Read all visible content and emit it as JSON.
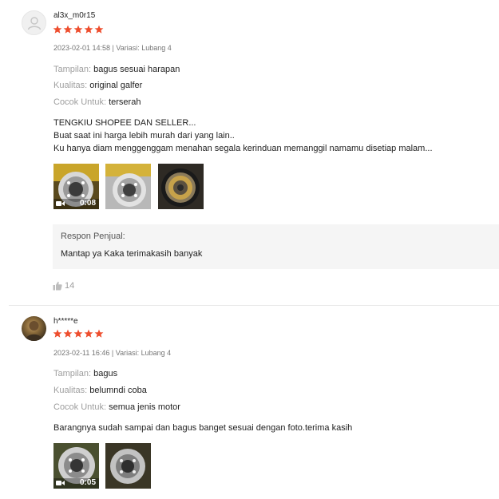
{
  "reviews": [
    {
      "username": "al3x_m0r15",
      "rating": 5,
      "meta": "2023-02-01 14:58 | Variasi: Lubang 4",
      "attributes": [
        {
          "key": "Tampilan:",
          "value": "bagus sesuai harapan"
        },
        {
          "key": "Kualitas:",
          "value": "original galfer"
        },
        {
          "key": "Cocok Untuk:",
          "value": "terserah"
        }
      ],
      "comment_lines": [
        "TENGKIU SHOPEE DAN SELLER...",
        "Buat saat ini harga lebih murah dari yang lain..",
        "Ku hanya diam menggenggam menahan segala kerinduan memanggil namamu disetiap malam..."
      ],
      "video_duration": "0:08",
      "seller_reply": {
        "title": "Respon Penjual:",
        "text": "Mantap ya Kaka terimakasih banyak"
      },
      "likes": "14"
    },
    {
      "username": "h*****e",
      "rating": 5,
      "meta": "2023-02-11 16:46 | Variasi: Lubang 4",
      "attributes": [
        {
          "key": "Tampilan:",
          "value": "bagus"
        },
        {
          "key": "Kualitas:",
          "value": "belumndi coba"
        },
        {
          "key": "Cocok Untuk:",
          "value": "semua jenis motor"
        }
      ],
      "comment_lines": [
        "Barangnya sudah sampai dan bagus banget sesuai dengan foto.terima kasih"
      ],
      "video_duration": "0:05"
    }
  ],
  "colors": {
    "star": "#ee4d2d",
    "reply_bg": "#f5f5f5",
    "muted": "#9e9e9e"
  }
}
